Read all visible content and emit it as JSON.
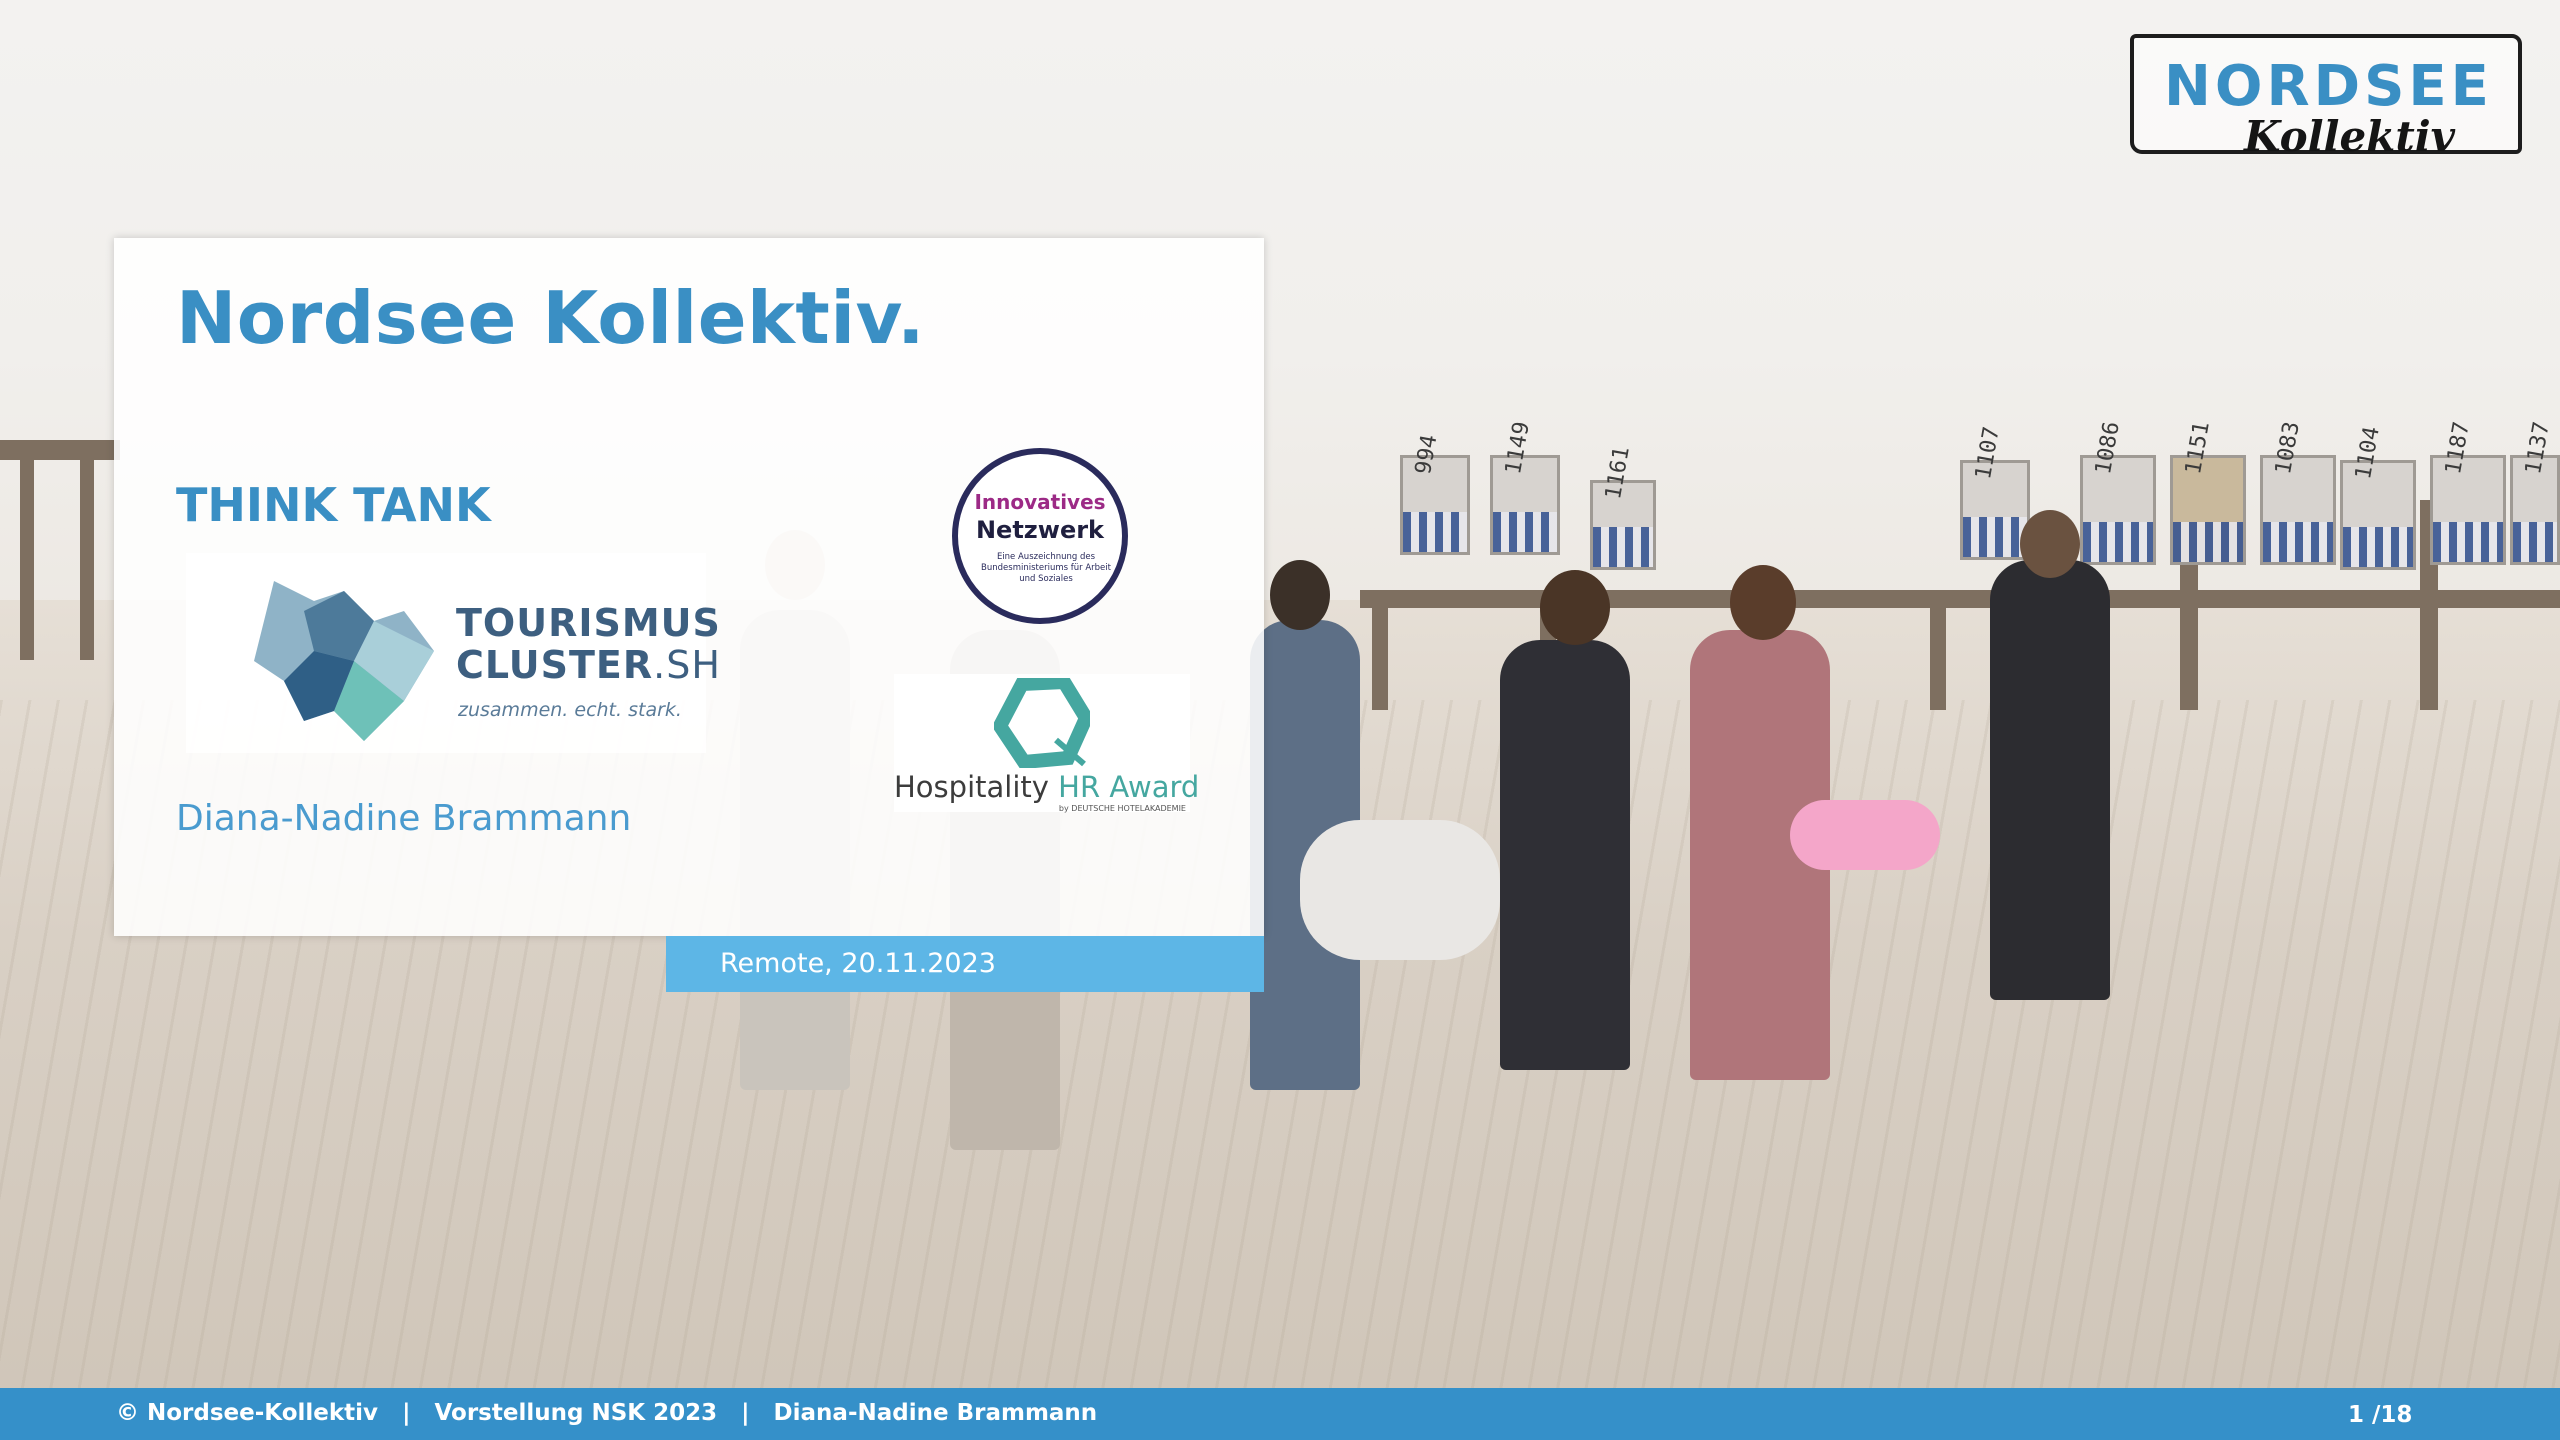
{
  "slide": {
    "title": "Nordsee Kollektiv.",
    "subtitle": "THINK TANK",
    "author": "Diana-Nadine Brammann",
    "date_line": "Remote, 20.11.2023"
  },
  "logos": {
    "tourismus_cluster": {
      "line1": "TOURISMUS",
      "line2a": "CLUSTER",
      "line2b": ".SH",
      "slogan": "zusammen. echt. stark."
    },
    "innovatives_netzwerk": {
      "line1": "Innovatives",
      "line2": "Netzwerk",
      "caption": "Eine Auszeichnung des Bundesministeriums für Arbeit und Soziales"
    },
    "hospitality_award": {
      "word1": "Hospitality ",
      "word2": "HR Award",
      "by": "by DEUTSCHE HOTELAKADEMIE"
    },
    "brand": {
      "line1": "NORDSEE",
      "line2": "Kollektiv"
    }
  },
  "beach_chairs": [
    "994",
    "1149",
    "1161",
    "1107",
    "1086",
    "1151",
    "1083",
    "1104",
    "1187",
    "1137"
  ],
  "footer": {
    "text": "© Nordsee-Kollektiv   |   Vorstellung NSK 2023   |   Diana-Nadine Brammann",
    "page": "1 /18"
  },
  "colors": {
    "accent": "#3a8fc4",
    "date_strip": "#5db6e6",
    "footer": "#3590c9",
    "seal_purple": "#9c2a86",
    "award_teal": "#45a7a0"
  }
}
